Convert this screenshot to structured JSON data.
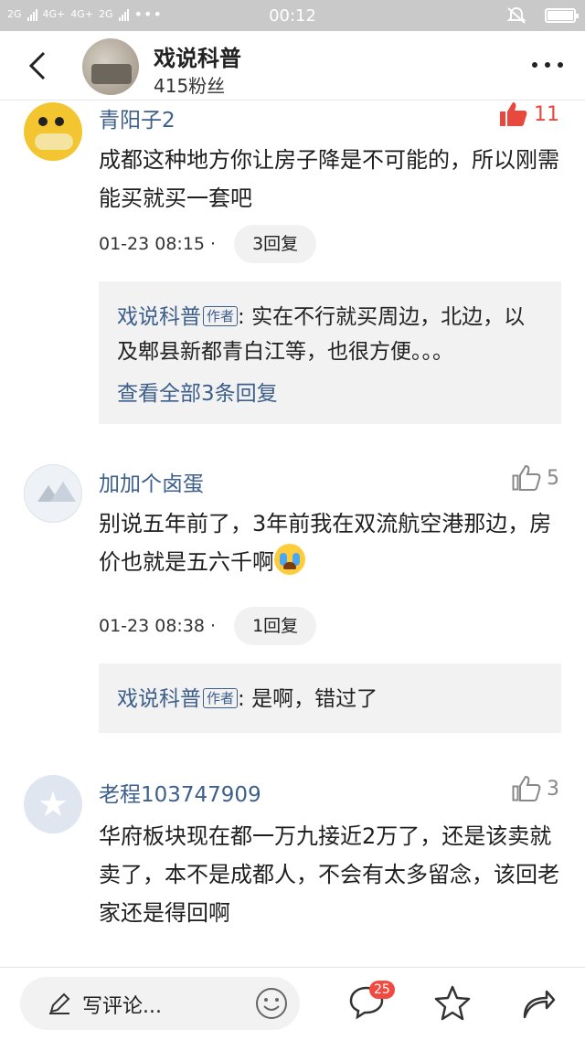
{
  "status_bar": {
    "network_1": "2G",
    "network_2": "4G+",
    "network_3": "4G+",
    "network_4": "2G",
    "time": "00:12"
  },
  "header": {
    "author_name": "戏说科普",
    "fans": "415粉丝"
  },
  "comments": [
    {
      "username": "青阳子2",
      "likes": "11",
      "liked": true,
      "text": "成都这种地方你让房子降是不可能的，所以刚需能买就买一套吧",
      "time": "01-23 08:15 ·",
      "replies_label": "3回复",
      "reply": {
        "name": "戏说科普",
        "tag": "作者",
        "text": ": 实在不行就买周边，北边，以及郫县新都青白江等，也很方便。。。",
        "view_all": "查看全部3条回复"
      }
    },
    {
      "username": "加加个卤蛋",
      "likes": "5",
      "liked": false,
      "text": "别说五年前了，3年前我在双流航空港那边，房价也就是五六千啊",
      "time": "01-23 08:38 ·",
      "replies_label": "1回复",
      "reply": {
        "name": "戏说科普",
        "tag": "作者",
        "text": ": 是啊，错过了"
      }
    },
    {
      "username": "老程103747909",
      "likes": "3",
      "liked": false,
      "text": "华府板块现在都一万九接近2万了，还是该卖就卖了，本不是成都人，不会有太多留念，该回老家还是得回啊"
    }
  ],
  "bottom_bar": {
    "write_placeholder": "写评论...",
    "comment_count": "25"
  },
  "colors": {
    "link_blue": "#3d5f8c",
    "like_red": "#e8493f",
    "badge_red": "#f04a41"
  }
}
